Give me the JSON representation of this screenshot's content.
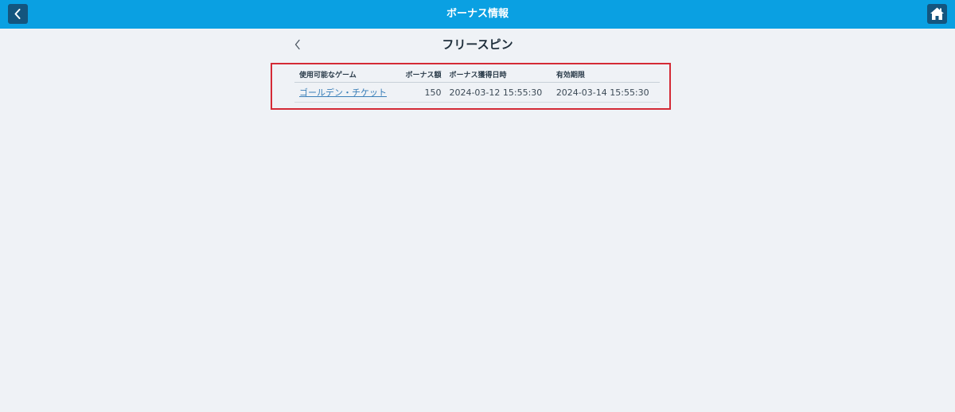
{
  "header": {
    "title": "ボーナス情報",
    "back_icon": "chevron-left-icon",
    "home_icon": "home-icon",
    "bar_color": "#0aa0e2",
    "button_color": "#14557e"
  },
  "subheader": {
    "title": "フリースピン",
    "back_icon": "chevron-left-icon"
  },
  "table": {
    "columns": [
      "使用可能なゲーム",
      "ボーナス額",
      "ボーナス獲得日時",
      "有効期限"
    ],
    "rows": [
      {
        "game": "ゴールデン・チケット",
        "amount": "150",
        "acquired": "2024-03-12 15:55:30",
        "expiry": "2024-03-14 15:55:30"
      }
    ]
  },
  "highlight_color": "#d42a36"
}
